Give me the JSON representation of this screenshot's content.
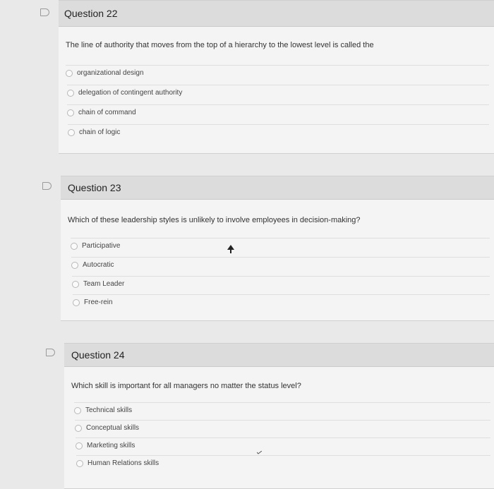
{
  "questions": [
    {
      "title": "Question 22",
      "prompt": "The line of authority that moves from the top of a hierarchy to the lowest level is called the",
      "options": [
        "organizational design",
        "delegation of contingent authority",
        "chain of command",
        "chain of logic"
      ]
    },
    {
      "title": "Question 23",
      "prompt": "Which of these leadership styles is unlikely to involve employees in decision-making?",
      "options": [
        "Participative",
        "Autocratic",
        "Team Leader",
        "Free-rein"
      ]
    },
    {
      "title": "Question 24",
      "prompt": "Which skill is important for all managers no matter the status level?",
      "options": [
        "Technical skills",
        "Conceptual skills",
        "Marketing skills",
        "Human Relations skills"
      ]
    }
  ],
  "icons": {
    "flag": "flag-icon",
    "radio": "radio-button",
    "cursor": "mouse-pointer-icon"
  }
}
